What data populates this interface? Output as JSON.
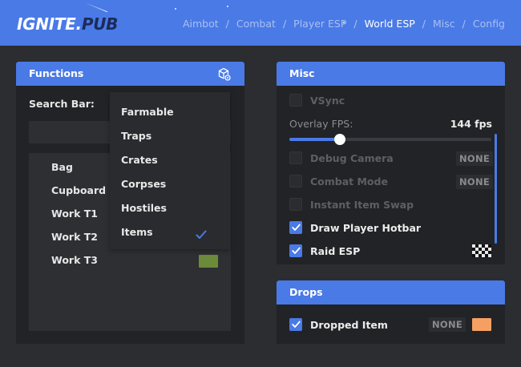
{
  "header": {
    "logo_part1": "IGNITE.",
    "logo_part2": "PUB",
    "tabs": [
      {
        "label": "Aimbot",
        "active": false
      },
      {
        "label": "Combat",
        "active": false
      },
      {
        "label": "Player ESP",
        "active": false
      },
      {
        "label": "World ESP",
        "active": true
      },
      {
        "label": "Misc",
        "active": false
      },
      {
        "label": "Config",
        "active": false
      }
    ],
    "separator": "/"
  },
  "colors": {
    "accent": "#4a7ae6",
    "background": "#2c2d30",
    "panel": "#222326",
    "work_t3_color": "#6b8a3a",
    "dropped_item_color": "#f5a062"
  },
  "functions": {
    "title": "Functions",
    "settings_icon": "gear-cube-icon",
    "search_label": "Search Bar:",
    "search_value": "",
    "list_items": [
      "Bag",
      "Cupboard",
      "Work T1",
      "Work T2",
      "Work T3"
    ],
    "dropdown": {
      "items": [
        "Farmable",
        "Traps",
        "Crates",
        "Corpses",
        "Hostiles",
        "Items"
      ],
      "checked": "Items"
    }
  },
  "misc": {
    "title": "Misc",
    "vsync_label": "VSync",
    "vsync_checked": false,
    "overlay_fps_label": "Overlay FPS:",
    "overlay_fps_value": "144 fps",
    "overlay_fps_fraction": 0.25,
    "rows": [
      {
        "label": "Debug Camera",
        "checked": false,
        "dim": true,
        "keybind": "NONE"
      },
      {
        "label": "Combat Mode",
        "checked": false,
        "dim": true,
        "keybind": "NONE"
      },
      {
        "label": "Instant Item Swap",
        "checked": false,
        "dim": true
      },
      {
        "label": "Draw Player Hotbar",
        "checked": true,
        "dim": false
      },
      {
        "label": "Raid ESP",
        "checked": true,
        "dim": false
      }
    ]
  },
  "drops": {
    "title": "Drops",
    "dropped_item_label": "Dropped Item",
    "dropped_item_checked": true,
    "dropped_item_keybind": "NONE"
  }
}
